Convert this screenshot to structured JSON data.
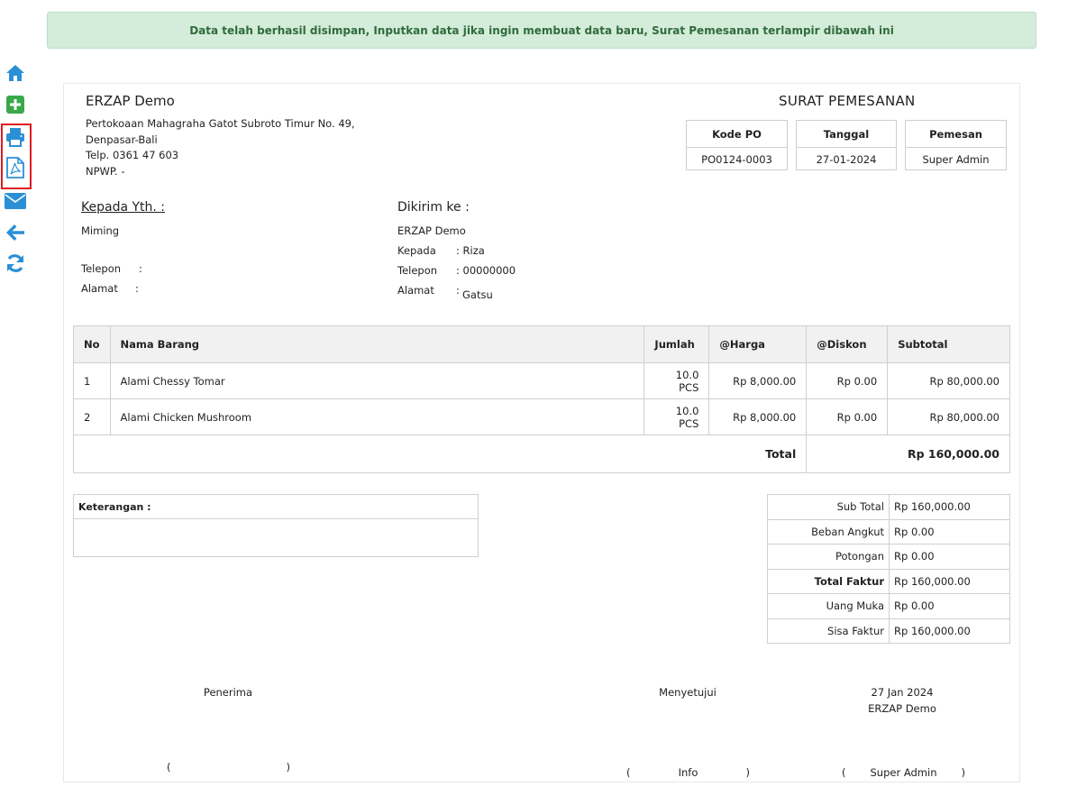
{
  "alert": "Data telah berhasil disimpan, Inputkan data jika ingin membuat data baru, Surat Pemesanan terlampir dibawah ini",
  "sidebar": {
    "items": [
      {
        "icon": "home-icon",
        "color": "#2b8fd6"
      },
      {
        "icon": "plus-square-icon",
        "color": "#3aa84a"
      },
      {
        "icon": "printer-icon",
        "color": "#2b8fd6"
      },
      {
        "icon": "pdf-icon",
        "color": "#2b8fd6"
      },
      {
        "icon": "envelope-icon",
        "color": "#2b8fd6"
      },
      {
        "icon": "arrow-left-icon",
        "color": "#2b8fd6"
      },
      {
        "icon": "refresh-icon",
        "color": "#2b8fd6"
      }
    ]
  },
  "company": {
    "name": "ERZAP Demo",
    "address1": "Pertokoaan Mahagraha Gatot Subroto Timur No. 49,",
    "address2": "Denpasar-Bali",
    "phone": "Telp. 0361 47 603",
    "npwp": "NPWP. -"
  },
  "document": {
    "title": "SURAT PEMESANAN",
    "kode_po_label": "Kode PO",
    "kode_po": "PO0124-0003",
    "tanggal_label": "Tanggal",
    "tanggal": "27-01-2024",
    "pemesan_label": "Pemesan",
    "pemesan": "Super Admin"
  },
  "to": {
    "title": "Kepada Yth. :",
    "name": "Miming",
    "telepon_label": "Telepon",
    "telepon": ":",
    "alamat_label": "Alamat",
    "alamat": ":"
  },
  "ship": {
    "title": "Dikirim ke :",
    "company": "ERZAP Demo",
    "kepada_label": "Kepada",
    "kepada": ": Riza",
    "telepon_label": "Telepon",
    "telepon": ": 00000000",
    "alamat_label": "Alamat",
    "alamat_sep": ":",
    "alamat": "Gatsu"
  },
  "items_table": {
    "headers": [
      "No",
      "Nama Barang",
      "Jumlah",
      "@Harga",
      "@Diskon",
      "Subtotal"
    ],
    "rows": [
      [
        "1",
        "Alami Chessy Tomar",
        "10.0 PCS",
        "Rp 8,000.00",
        "Rp 0.00",
        "Rp 80,000.00"
      ],
      [
        "2",
        "Alami Chicken Mushroom",
        "10.0 PCS",
        "Rp 8,000.00",
        "Rp 0.00",
        "Rp 80,000.00"
      ]
    ],
    "total_label": "Total",
    "total_value": "Rp 160,000.00"
  },
  "keterangan": {
    "label": "Keterangan :"
  },
  "summary": {
    "rows": [
      {
        "label": "Sub Total",
        "value": "Rp 160,000.00"
      },
      {
        "label": "Beban Angkut",
        "value": "Rp 0.00"
      },
      {
        "label": "Potongan",
        "value": "Rp 0.00"
      },
      {
        "label": "Total Faktur",
        "value": "Rp 160,000.00"
      },
      {
        "label": "Uang Muka",
        "value": "Rp 0.00"
      },
      {
        "label": "Sisa Faktur",
        "value": "Rp 160,000.00"
      }
    ]
  },
  "signatures": {
    "penerima": "Penerima",
    "menyetujui": "Menyetujui",
    "date": "27 Jan 2024",
    "company": "ERZAP Demo",
    "penerima_name": "",
    "menyetujui_name": "Info",
    "admin_name": "Super Admin"
  }
}
